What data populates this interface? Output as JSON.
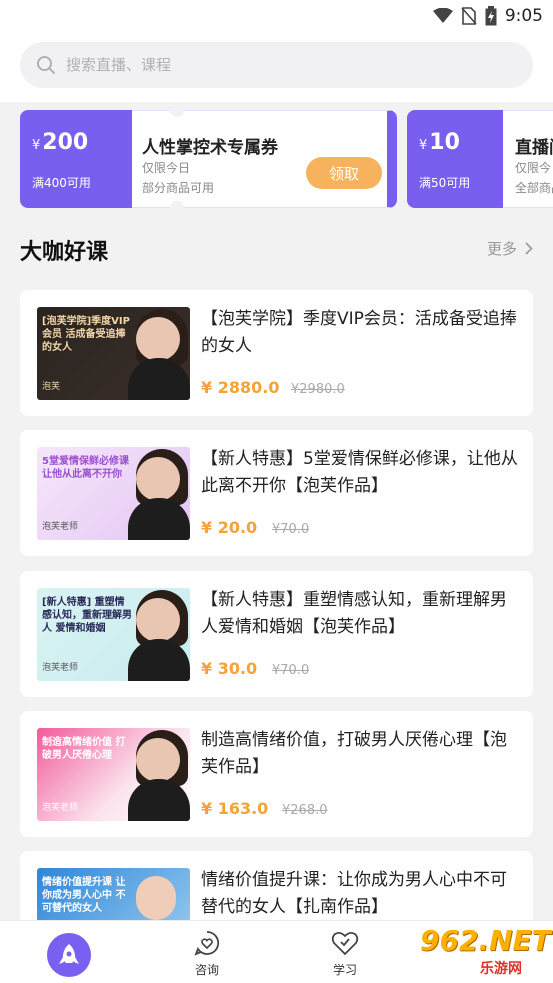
{
  "status_bar": {
    "time": "9:05",
    "icons": [
      "wifi-icon",
      "no-sim-icon",
      "battery-icon"
    ]
  },
  "search": {
    "placeholder": "搜索直播、课程",
    "value": ""
  },
  "coupons": [
    {
      "currency": "¥",
      "amount": "200",
      "condition": "满400可用",
      "title": "人性掌控术专属券",
      "validity": "仅限今日",
      "scope": "部分商品可用",
      "button": "领取"
    },
    {
      "currency": "¥",
      "amount": "10",
      "condition": "满50可用",
      "title": "直播间",
      "validity": "仅限今日",
      "scope": "全部商品"
    }
  ],
  "section": {
    "title": "大咖好课",
    "more_label": "更多"
  },
  "courses": [
    {
      "title": "【泡芙学院】季度VIP会员：活成备受追捧的女人",
      "price": "¥ 2880.0",
      "original_price": "¥2980.0",
      "thumb_text": "[泡芙学院]季度VIP会员 活成备受追捧的女人",
      "thumb_sub": "泡芙"
    },
    {
      "title": "【新人特惠】5堂爱情保鲜必修课，让他从此离不开你【泡芙作品】",
      "price": "¥ 20.0",
      "original_price": "¥70.0",
      "thumb_text": "5堂爱情保鲜必修课 让他从此离不开你",
      "thumb_sub": "泡芙老师"
    },
    {
      "title": "【新人特惠】重塑情感认知，重新理解男人爱情和婚姻【泡芙作品】",
      "price": "¥ 30.0",
      "original_price": "¥70.0",
      "thumb_text": "[新人特惠] 重塑情感认知，重新理解男人 爱情和婚姻",
      "thumb_sub": "泡芙老师"
    },
    {
      "title": "制造高情绪价值，打破男人厌倦心理【泡芙作品】",
      "price": "¥ 163.0",
      "original_price": "¥268.0",
      "thumb_text": "制造高情绪价值 打破男人厌倦心理",
      "thumb_sub": "泡芙老师"
    },
    {
      "title": "情绪价值提升课：让你成为男人心中不可替代的女人【扎南作品】",
      "thumb_text": "情绪价值提升课 让你成为男人心中 不可替代的女人",
      "thumb_sub": ""
    }
  ],
  "bottom_nav": [
    {
      "label": "",
      "icon": "rocket-icon",
      "active": true
    },
    {
      "label": "咨询",
      "icon": "chat-heart-icon",
      "active": false
    },
    {
      "label": "学习",
      "icon": "heart-book-icon",
      "active": false
    }
  ],
  "watermark": {
    "big": "962.NET",
    "small": "乐游网"
  },
  "colors": {
    "accent": "#7a5ef0",
    "price": "#f3a33a",
    "claim_button": "#f7b25e"
  }
}
